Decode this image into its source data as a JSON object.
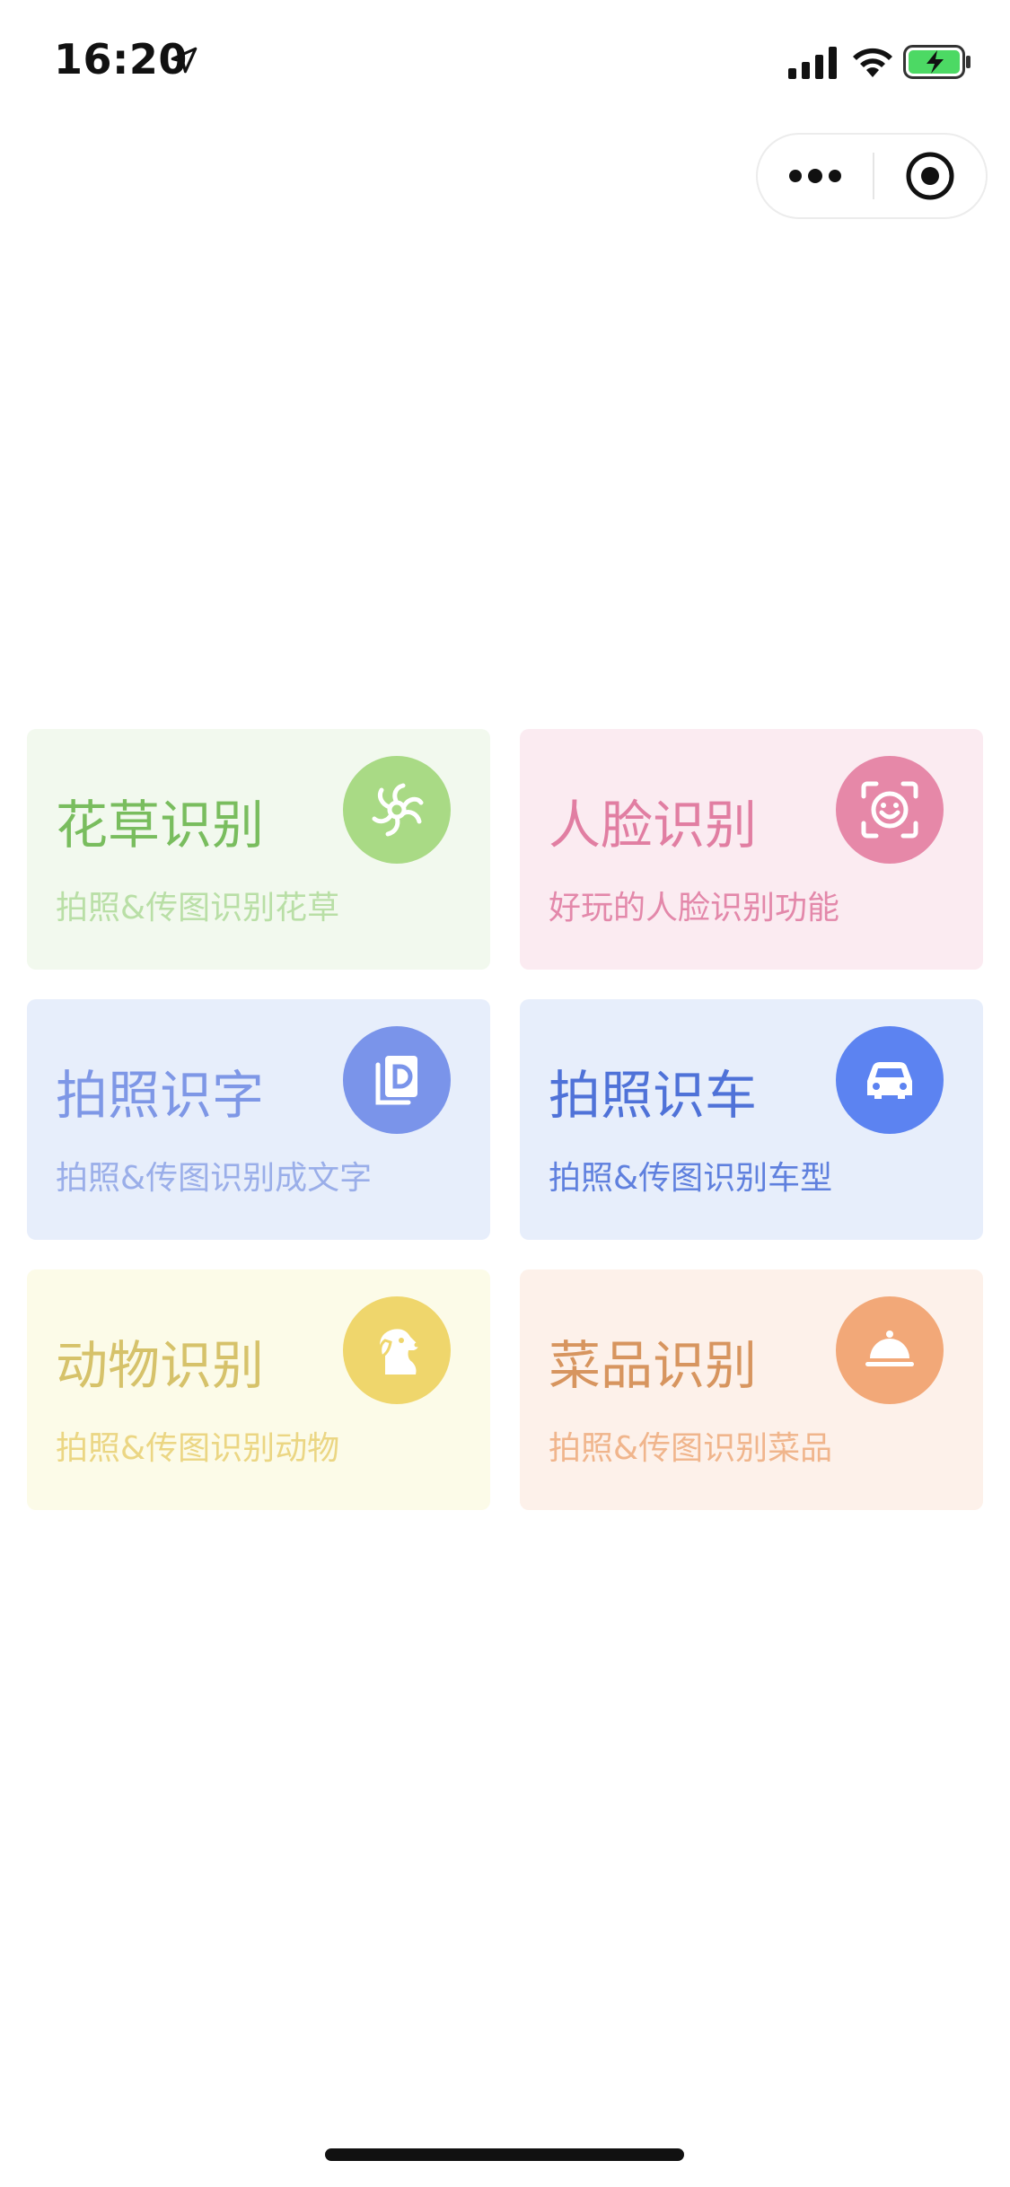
{
  "status_bar": {
    "time": "16:20",
    "icons": [
      "location-arrow-icon",
      "signal-icon",
      "wifi-icon",
      "battery-charging-icon"
    ]
  },
  "capsule": {
    "icons": [
      "more-dots-icon",
      "close-target-icon"
    ]
  },
  "cards": [
    {
      "title": "花草识别",
      "subtitle": "拍照&传图识别花草",
      "icon": "flower-icon",
      "colors": {
        "bg": "#f2f9ee",
        "title": "#79bd5e",
        "sub": "#b9dfa6",
        "icon_bg": "#a9da85"
      }
    },
    {
      "title": "人脸识别",
      "subtitle": "好玩的人脸识别功能",
      "icon": "face-icon",
      "colors": {
        "bg": "#fbebf1",
        "title": "#e17ea2",
        "sub": "#e388aa",
        "icon_bg": "#e688a8"
      }
    },
    {
      "title": "拍照识字",
      "subtitle": "拍照&传图识别成文字",
      "icon": "document-icon",
      "colors": {
        "bg": "#e7eefb",
        "title": "#7e97e6",
        "sub": "#9aaee9",
        "icon_bg": "#7a94ea"
      }
    },
    {
      "title": "拍照识车",
      "subtitle": "拍照&传图识别车型",
      "icon": "car-icon",
      "colors": {
        "bg": "#e7eefb",
        "title": "#4f72d8",
        "sub": "#5f80de",
        "icon_bg": "#5c83f1"
      }
    },
    {
      "title": "动物识别",
      "subtitle": "拍照&传图识别动物",
      "icon": "dog-icon",
      "colors": {
        "bg": "#fcfbe8",
        "title": "#d6c26a",
        "sub": "#ebd683",
        "icon_bg": "#efd66c"
      }
    },
    {
      "title": "菜品识别",
      "subtitle": "拍照&传图识别菜品",
      "icon": "food-dome-icon",
      "colors": {
        "bg": "#fdf1ea",
        "title": "#d7955f",
        "sub": "#f0b58c",
        "icon_bg": "#f2a878"
      }
    }
  ]
}
